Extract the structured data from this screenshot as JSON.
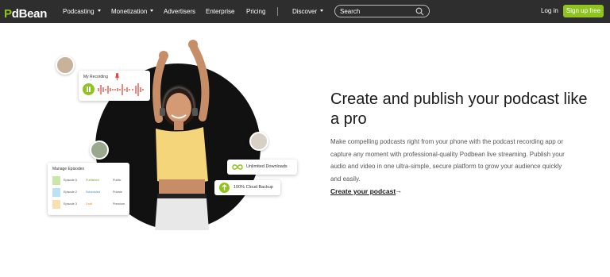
{
  "nav": {
    "logo": {
      "p": "P",
      "rest": "dBean"
    },
    "items": [
      {
        "label": "Podcasting",
        "dropdown": true
      },
      {
        "label": "Monetization",
        "dropdown": true
      },
      {
        "label": "Advertisers",
        "dropdown": false
      },
      {
        "label": "Enterprise",
        "dropdown": false
      },
      {
        "label": "Pricing",
        "dropdown": false
      },
      {
        "label": "Discover",
        "dropdown": true
      }
    ],
    "search_placeholder": "Search",
    "login": "Log in",
    "signup": "Sign up free"
  },
  "hero": {
    "heading": "Create and publish your podcast like a pro",
    "description": "Make compelling podcasts right from your phone with the podcast recording app or capture any moment with professional-quality Podbean live streaming. Publish your audio and video in one ultra-simple, secure platform to grow your audience quickly and easily.",
    "cta": "Create your podcast",
    "cta_arrow": "→"
  },
  "recording_card": {
    "title": "My Recording"
  },
  "manage_card": {
    "title": "Manage Episodes",
    "episodes": [
      {
        "name": "Episode 5",
        "status": "Published",
        "visibility": "Public"
      },
      {
        "name": "Episode 2",
        "status": "Scheduled",
        "visibility": "Private"
      },
      {
        "name": "Episode 3",
        "status": "Draft",
        "visibility": "Premium"
      }
    ]
  },
  "features": {
    "unlimited_downloads": "Unlimited Downloads",
    "cloud_backup": "100% Cloud Backup"
  },
  "colors": {
    "brand_green": "#8fc31f",
    "nav_bg": "#2e2e2e",
    "recording_red": "#e8453c"
  },
  "icons": [
    "podbean-logo",
    "chevron-down-icon",
    "search-icon",
    "microphone-icon",
    "pause-icon",
    "infinity-icon",
    "cloud-upload-icon",
    "arrow-right-icon"
  ]
}
